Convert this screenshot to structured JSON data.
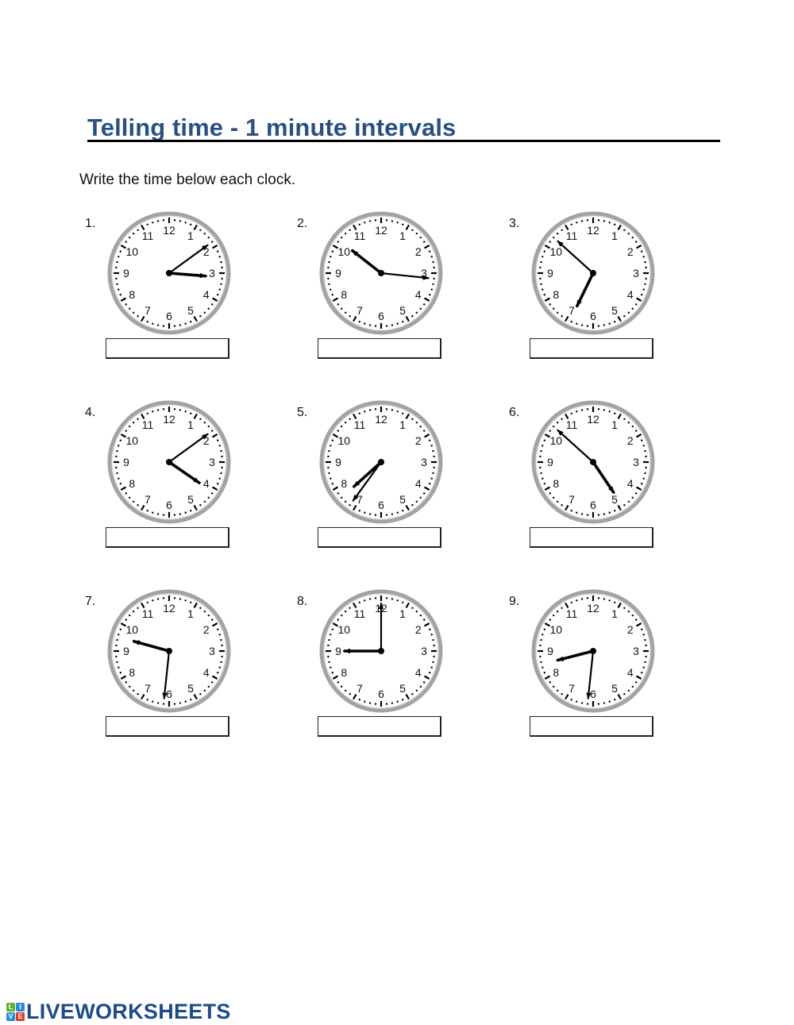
{
  "worksheet": {
    "title": "Telling time - 1 minute intervals",
    "instructions": "Write the time below each clock.",
    "title_color": "#2a5082"
  },
  "clock_face": {
    "numerals": [
      "12",
      "1",
      "2",
      "3",
      "4",
      "5",
      "6",
      "7",
      "8",
      "9",
      "10",
      "11"
    ],
    "rim_color": "#a3a3a3",
    "hand_color": "#000000"
  },
  "items": [
    {
      "number": "1.",
      "hours": 3,
      "minutes": 9,
      "answer": ""
    },
    {
      "number": "2.",
      "hours": 10,
      "minutes": 16,
      "answer": ""
    },
    {
      "number": "3.",
      "hours": 6,
      "minutes": 52,
      "answer": ""
    },
    {
      "number": "4.",
      "hours": 4,
      "minutes": 9,
      "answer": ""
    },
    {
      "number": "5.",
      "hours": 7,
      "minutes": 36,
      "answer": ""
    },
    {
      "number": "6.",
      "hours": 4,
      "minutes": 52,
      "answer": ""
    },
    {
      "number": "7.",
      "hours": 9,
      "minutes": 31,
      "answer": ""
    },
    {
      "number": "8.",
      "hours": 9,
      "minutes": 0,
      "answer": ""
    },
    {
      "number": "9.",
      "hours": 8,
      "minutes": 31,
      "answer": ""
    }
  ],
  "footer": {
    "logo_letters": [
      {
        "char": "L",
        "color": "#5bb531"
      },
      {
        "char": "I",
        "color": "#2e8bd6"
      },
      {
        "char": "V",
        "color": "#2e8bd6"
      },
      {
        "char": "E",
        "color": "#e2352f"
      }
    ],
    "logo_text": "LIVEWORKSHEETS"
  }
}
